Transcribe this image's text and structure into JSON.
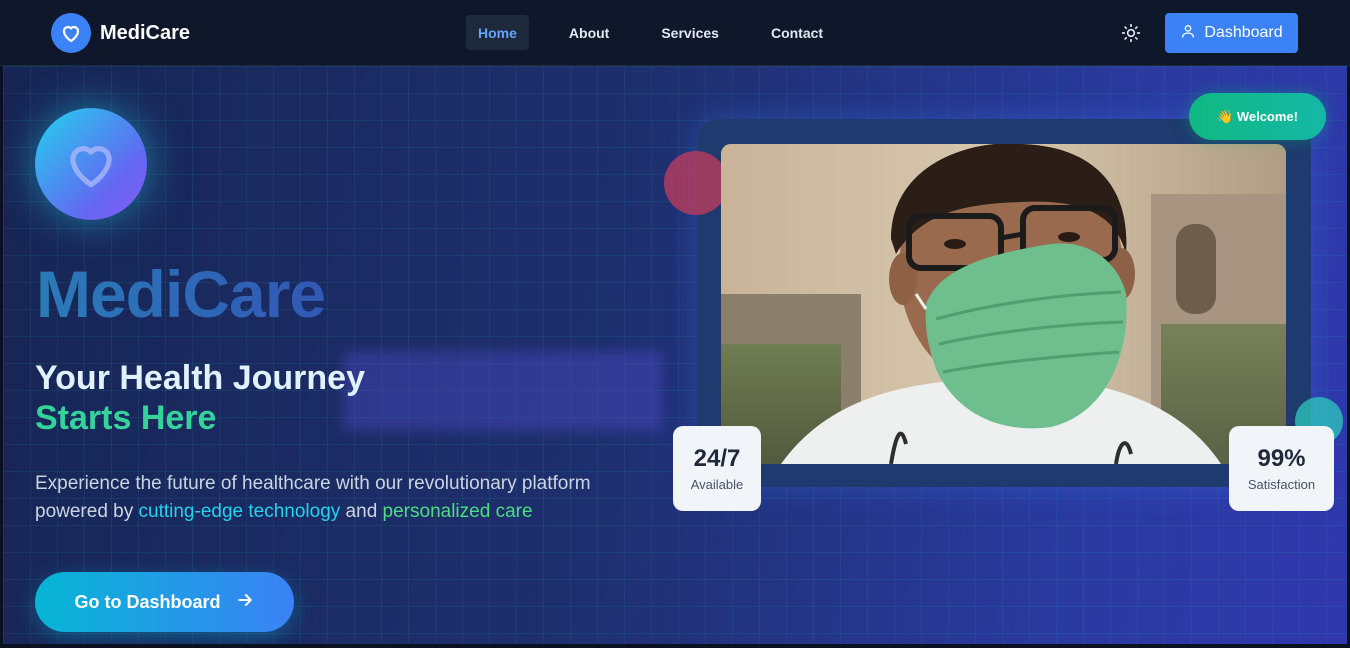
{
  "brand": {
    "name": "MediCare",
    "logo_icon": "heart-icon",
    "color": "#3b82f6"
  },
  "nav": {
    "items": [
      {
        "label": "Home",
        "active": true
      },
      {
        "label": "About",
        "active": false
      },
      {
        "label": "Services",
        "active": false
      },
      {
        "label": "Contact",
        "active": false
      }
    ],
    "theme_icon": "sun-icon",
    "dashboard_button": {
      "label": "Dashboard",
      "icon": "user-icon"
    }
  },
  "hero": {
    "title": "MediCare",
    "tagline_line1": "Your Health Journey",
    "tagline_line2": "Starts Here",
    "description_prefix": "Experience the future of healthcare with our revolutionary platform powered by ",
    "highlight_1": "cutting-edge technology",
    "description_mid": " and ",
    "highlight_2": "personalized care",
    "cta": {
      "label": "Go to Dashboard",
      "icon": "arrow-right-icon"
    }
  },
  "showcase": {
    "welcome_badge": "👋 Welcome!",
    "stats": [
      {
        "value": "24/7",
        "label": "Available"
      },
      {
        "value": "99%",
        "label": "Satisfaction"
      }
    ]
  },
  "colors": {
    "accent": "#3b82f6",
    "teal": "#22d3ee",
    "green": "#34d399",
    "background": "#0f172a"
  }
}
